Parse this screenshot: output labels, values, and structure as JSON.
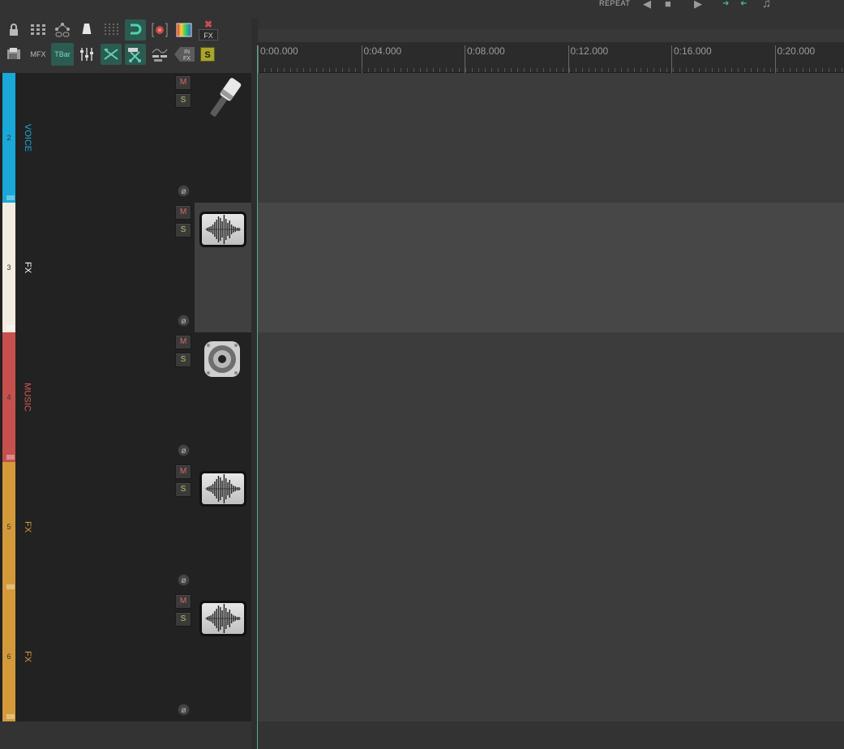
{
  "transport": {
    "labels": [
      "REPEAT"
    ]
  },
  "toolbar": {
    "mfx_label": "MFX",
    "tbar_label": "TBar",
    "in_fx_label": "IN FX",
    "solo_label": "S",
    "fx_label": "FX"
  },
  "ruler": {
    "marks": [
      "0:00.000",
      "0:04.000",
      "0:08.000",
      "0:12.000",
      "0:16.000",
      "0:20.000"
    ]
  },
  "tracks": [
    {
      "number": "2",
      "name": "VOICE",
      "color": "#19a8d9",
      "name_color": "#1fa9dc",
      "icon": "microphone-icon",
      "mute": "M",
      "solo": "S",
      "phase": "ø"
    },
    {
      "number": "3",
      "name": "FX",
      "color": "#f3ece0",
      "name_color": "#ffffff",
      "icon": "waveform-icon",
      "mute": "M",
      "solo": "S",
      "phase": "ø"
    },
    {
      "number": "4",
      "name": "MUSIC",
      "color": "#c5504d",
      "name_color": "#d85a56",
      "icon": "speaker-icon",
      "mute": "M",
      "solo": "S",
      "phase": "ø"
    },
    {
      "number": "5",
      "name": "FX",
      "color": "#d49a3a",
      "name_color": "#d89b3b",
      "icon": "waveform-icon",
      "mute": "M",
      "solo": "S",
      "phase": "ø"
    },
    {
      "number": "6",
      "name": "FX",
      "color": "#d49a3a",
      "name_color": "#d89b3b",
      "icon": "waveform-icon",
      "mute": "M",
      "solo": "S",
      "phase": "ø"
    }
  ],
  "colors": {
    "lane_dark": "#3c3c3c",
    "lane_light": "#474747",
    "accent": "#3cbf9d"
  }
}
